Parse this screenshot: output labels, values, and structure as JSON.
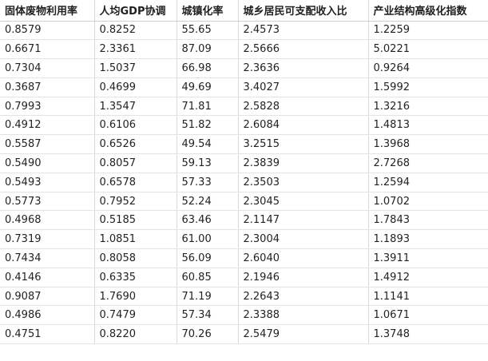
{
  "table": {
    "columns": [
      "固体废物利用率",
      "人均GDP协调",
      "城镇化率",
      "城乡居民可支配收入比",
      "产业结构高级化指数"
    ],
    "rows": [
      [
        "0.8579",
        "0.8252",
        "55.65",
        "2.4573",
        "1.2259"
      ],
      [
        "0.6671",
        "2.3361",
        "87.09",
        "2.5666",
        "5.0221"
      ],
      [
        "0.7304",
        "1.5037",
        "66.98",
        "2.3636",
        "0.9264"
      ],
      [
        "0.3687",
        "0.4699",
        "49.69",
        "3.4027",
        "1.5992"
      ],
      [
        "0.7993",
        "1.3547",
        "71.81",
        "2.5828",
        "1.3216"
      ],
      [
        "0.4912",
        "0.6106",
        "51.82",
        "2.6084",
        "1.4813"
      ],
      [
        "0.5587",
        "0.6526",
        "49.54",
        "3.2515",
        "1.3968"
      ],
      [
        "0.5490",
        "0.8057",
        "59.13",
        "2.3839",
        "2.7268"
      ],
      [
        "0.5493",
        "0.6578",
        "57.33",
        "2.3503",
        "1.2594"
      ],
      [
        "0.5773",
        "0.7952",
        "52.24",
        "2.3045",
        "1.0702"
      ],
      [
        "0.4968",
        "0.5185",
        "63.46",
        "2.1147",
        "1.7843"
      ],
      [
        "0.7319",
        "1.0851",
        "61.00",
        "2.3004",
        "1.1893"
      ],
      [
        "0.7434",
        "0.8058",
        "56.09",
        "2.6040",
        "1.3911"
      ],
      [
        "0.4146",
        "0.6335",
        "60.85",
        "2.1946",
        "1.4912"
      ],
      [
        "0.9087",
        "1.7690",
        "71.19",
        "2.2643",
        "1.1141"
      ],
      [
        "0.4986",
        "0.7479",
        "57.34",
        "2.3388",
        "1.0671"
      ],
      [
        "0.4751",
        "0.8220",
        "70.26",
        "2.5479",
        "1.3748"
      ]
    ]
  }
}
